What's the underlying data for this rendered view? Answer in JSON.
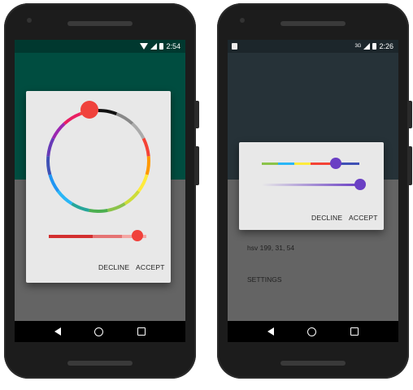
{
  "left_phone": {
    "status_time": "2:54",
    "dialog": {
      "decline_label": "DECLINE",
      "accept_label": "ACCEPT",
      "selected_color": "#f0423c",
      "hue_value": 0,
      "lightness_value": 0.92
    },
    "colors": {
      "app_bar": "#004d40",
      "background": "#646464",
      "dialog": "#e8e8e8"
    }
  },
  "right_phone": {
    "status_time": "2:26",
    "status_network": "3G",
    "dialog": {
      "decline_label": "DECLINE",
      "accept_label": "ACCEPT",
      "selected_color": "#6a3fc4",
      "hue_value": 0.72,
      "saturation_value": 1.0
    },
    "content": {
      "hsv_text": "hsv 199, 31, 54",
      "settings_label": "SETTINGS"
    },
    "colors": {
      "app_bar": "#263238",
      "background": "#646464",
      "dialog": "#e8e8e8"
    }
  }
}
